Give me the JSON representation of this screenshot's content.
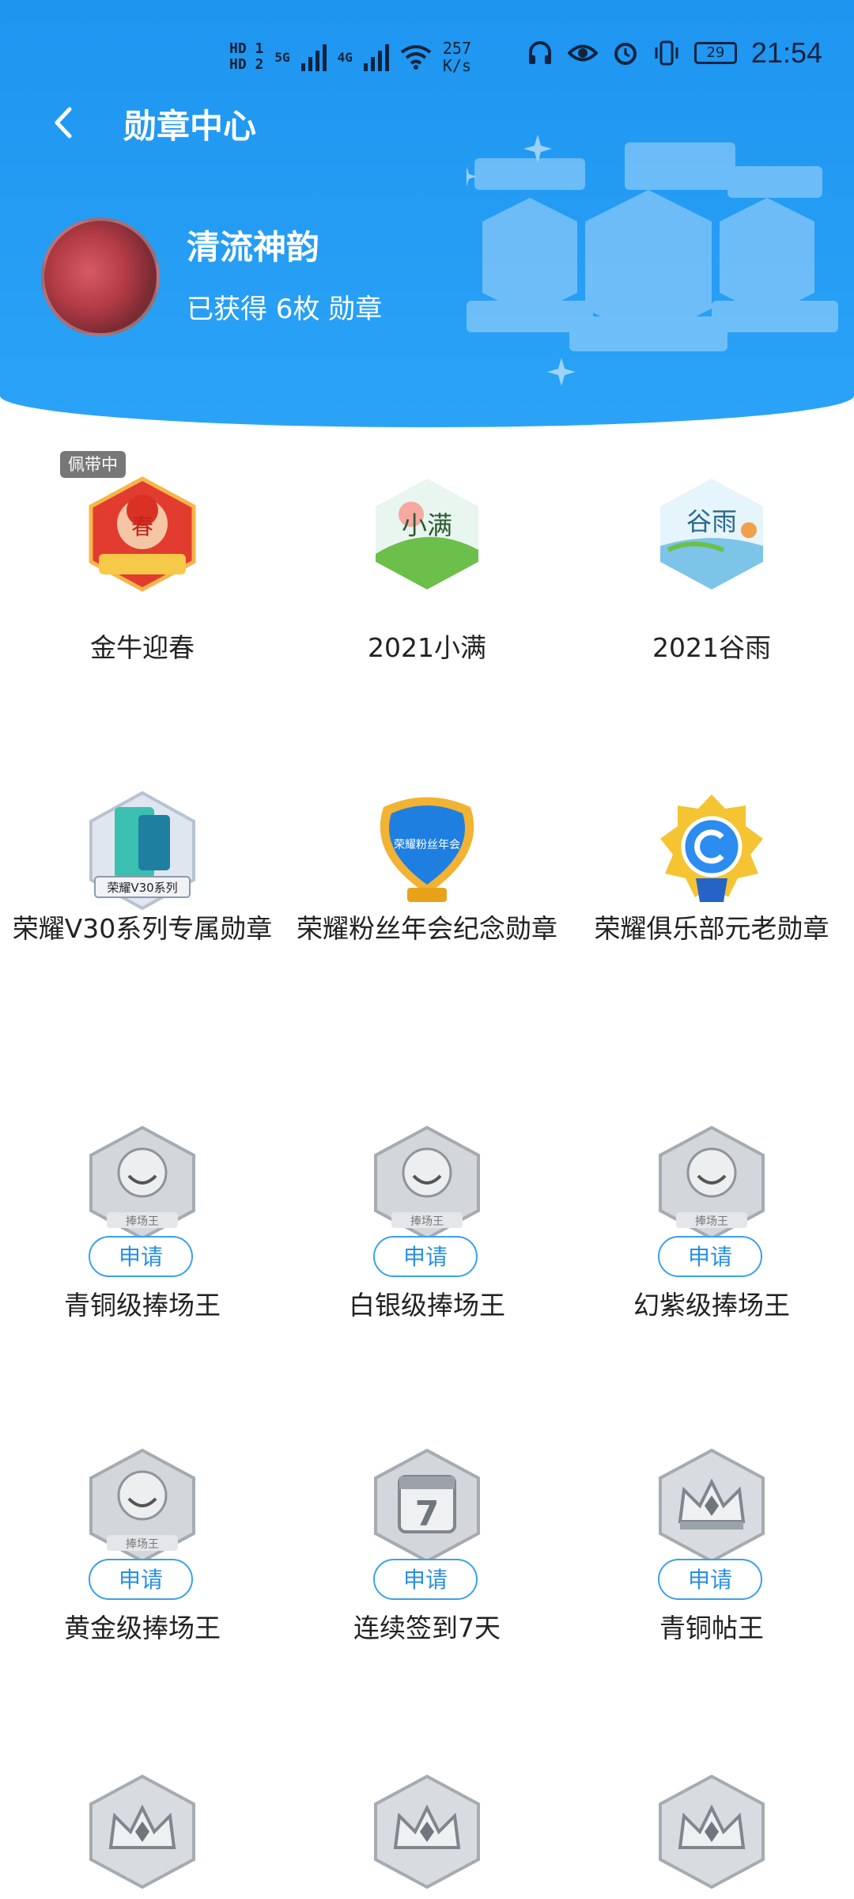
{
  "status_bar": {
    "hd1": "HD 1",
    "hd2": "HD 2",
    "net_5g": "5G",
    "net_4g": "4G",
    "speed_value": "257",
    "speed_unit": "K/s",
    "battery": "29",
    "time": "21:54"
  },
  "header": {
    "title": "勋章中心"
  },
  "profile": {
    "username": "清流神韵",
    "medal_count": "已获得 6枚 勋章"
  },
  "badges": [
    {
      "name": "金牛迎春",
      "tag": "佩带中",
      "art_text": "春"
    },
    {
      "name": "2021小满",
      "art_text": "小满"
    },
    {
      "name": "2021谷雨",
      "art_text": "谷雨"
    },
    {
      "name": "荣耀V30系列专属勋章",
      "art_text": "荣耀V30系列"
    },
    {
      "name": "荣耀粉丝年会纪念勋章",
      "art_text": "荣耀粉丝年会"
    },
    {
      "name": "荣耀俱乐部元老勋章"
    },
    {
      "name": "青铜级捧场王",
      "button": "申请",
      "art_text": "捧场王"
    },
    {
      "name": "白银级捧场王",
      "button": "申请",
      "art_text": "捧场王"
    },
    {
      "name": "幻紫级捧场王",
      "button": "申请",
      "art_text": "捧场王"
    },
    {
      "name": "黄金级捧场王",
      "button": "申请",
      "art_text": "捧场王"
    },
    {
      "name": "连续签到7天",
      "button": "申请",
      "art_text": "7"
    },
    {
      "name": "青铜帖王",
      "button": "申请"
    },
    {
      "name": "",
      "button": ""
    },
    {
      "name": "",
      "button": ""
    },
    {
      "name": "",
      "button": ""
    }
  ]
}
